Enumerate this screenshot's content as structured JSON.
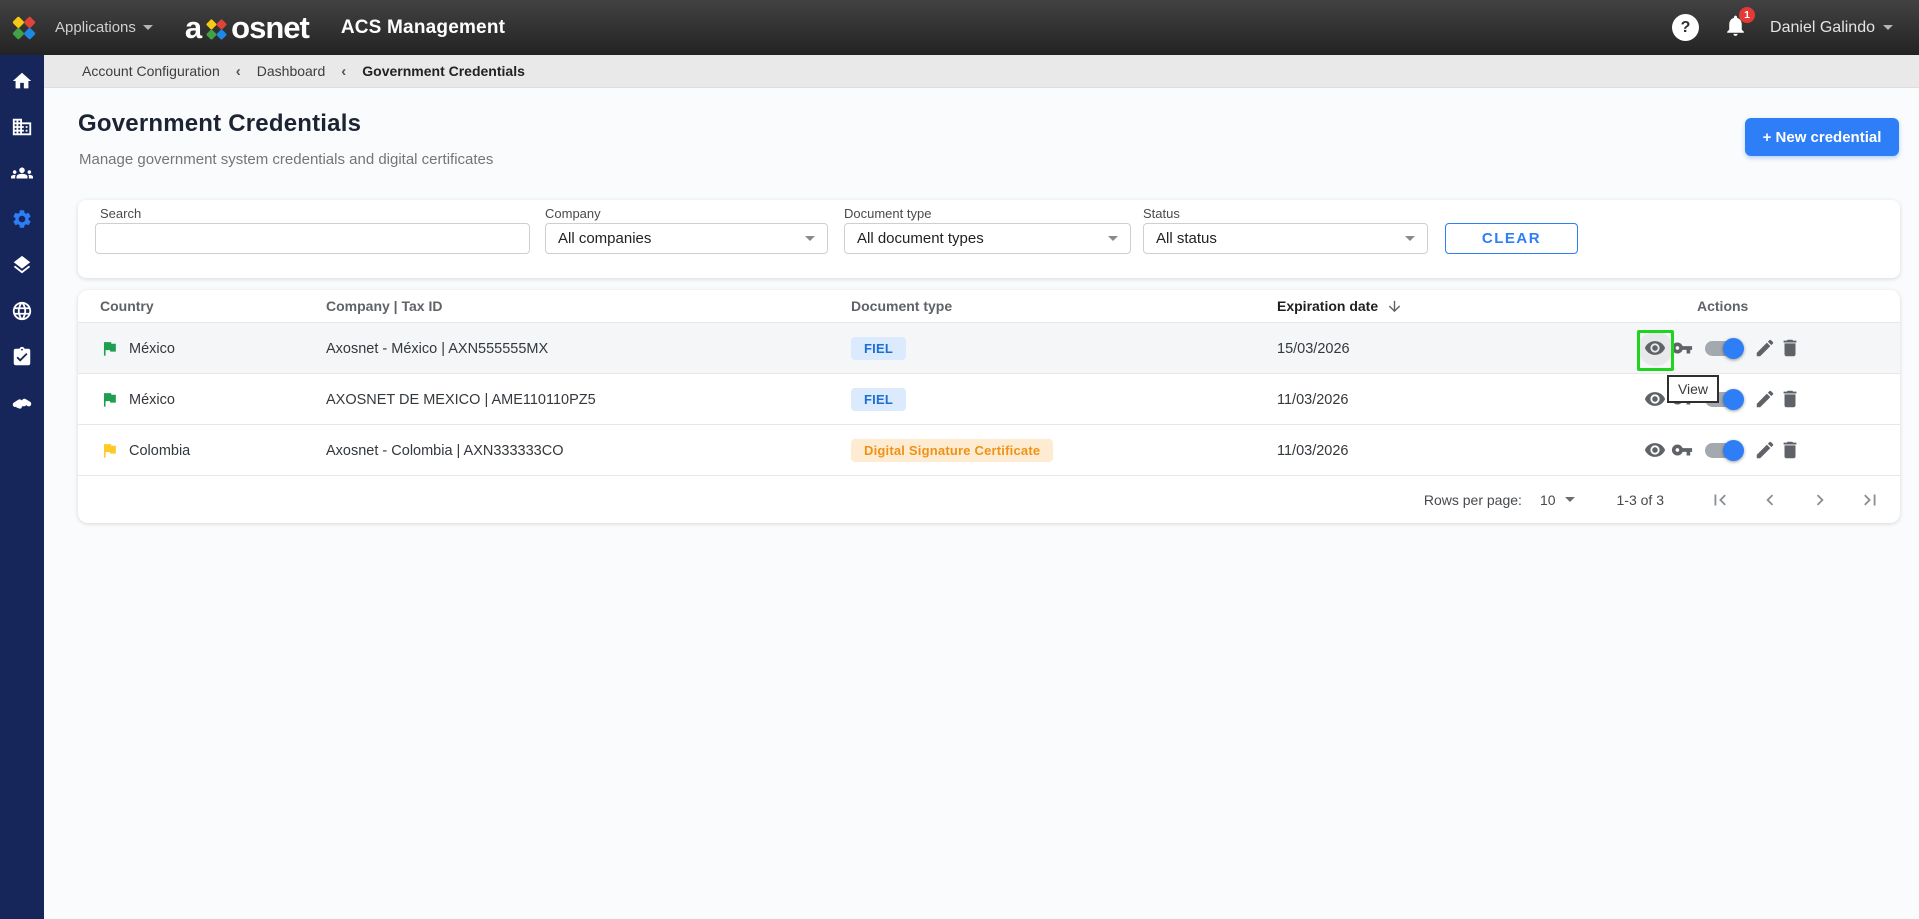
{
  "topbar": {
    "applications_label": "Applications",
    "brand_word_start": "a",
    "brand_word_end": "osnet",
    "app_title": "ACS Management",
    "help_glyph": "?",
    "notification_count": "1",
    "user_name": "Daniel Galindo"
  },
  "breadcrumb": {
    "items": [
      "Account Configuration",
      "Dashboard",
      "Government Credentials"
    ],
    "separator": "‹"
  },
  "sidebar": {
    "items": [
      {
        "icon": "home-icon"
      },
      {
        "icon": "building-icon"
      },
      {
        "icon": "users-icon"
      },
      {
        "icon": "settings-gear-icon",
        "active": true
      },
      {
        "icon": "layers-icon"
      },
      {
        "icon": "globe-icon"
      },
      {
        "icon": "clipboard-check-icon"
      },
      {
        "icon": "handshake-icon"
      }
    ]
  },
  "page": {
    "title": "Government Credentials",
    "subtitle": "Manage government system credentials and digital certificates",
    "new_credential_button": "+ New credential"
  },
  "filters": {
    "search_label": "Search",
    "search_value": "",
    "company_label": "Company",
    "company_value": "All companies",
    "document_type_label": "Document type",
    "document_type_value": "All document types",
    "status_label": "Status",
    "status_value": "All status",
    "clear_button": "CLEAR"
  },
  "table": {
    "columns": {
      "country": "Country",
      "company_tax_id": "Company | Tax ID",
      "document_type": "Document type",
      "expiration_date": "Expiration date",
      "actions": "Actions"
    },
    "sort": {
      "column": "Expiration date",
      "direction": "descending"
    },
    "rows": [
      {
        "country": "México",
        "flag_color": "#1E9E4F",
        "company_tax_id": "Axosnet - México | AXN555555MX",
        "document_type": "FIEL",
        "badge_style": "blue",
        "expiration_date": "15/03/2026",
        "toggle_on": true
      },
      {
        "country": "México",
        "flag_color": "#1E9E4F",
        "company_tax_id": "AXOSNET DE MEXICO | AME110110PZ5",
        "document_type": "FIEL",
        "badge_style": "blue",
        "expiration_date": "11/03/2026",
        "toggle_on": true
      },
      {
        "country": "Colombia",
        "flag_color": "#FFC928",
        "company_tax_id": "Axosnet - Colombia | AXN333333CO",
        "document_type": "Digital Signature Certificate",
        "badge_style": "orange",
        "expiration_date": "11/03/2026",
        "toggle_on": true
      }
    ]
  },
  "tooltip": {
    "text": "View"
  },
  "pagination": {
    "rows_per_page_label": "Rows per page:",
    "rows_per_page_value": "10",
    "range_label": "1-3 of 3"
  },
  "colors": {
    "accent_blue": "#2D7EF7",
    "sidebar_navy": "#16265A",
    "active_icon_blue": "#2E7DF6",
    "badge_blue_bg": "#DBEAFC",
    "badge_blue_text": "#1D6FD3",
    "badge_orange_bg": "#FDECD2",
    "badge_orange_text": "#EF9216",
    "flag_mexico": "#1E9E4F",
    "flag_colombia": "#FFC928",
    "annotation_green": "#1FD41F",
    "notification_red": "#E53935",
    "toggle_knob_on": "#2D7EF7"
  }
}
